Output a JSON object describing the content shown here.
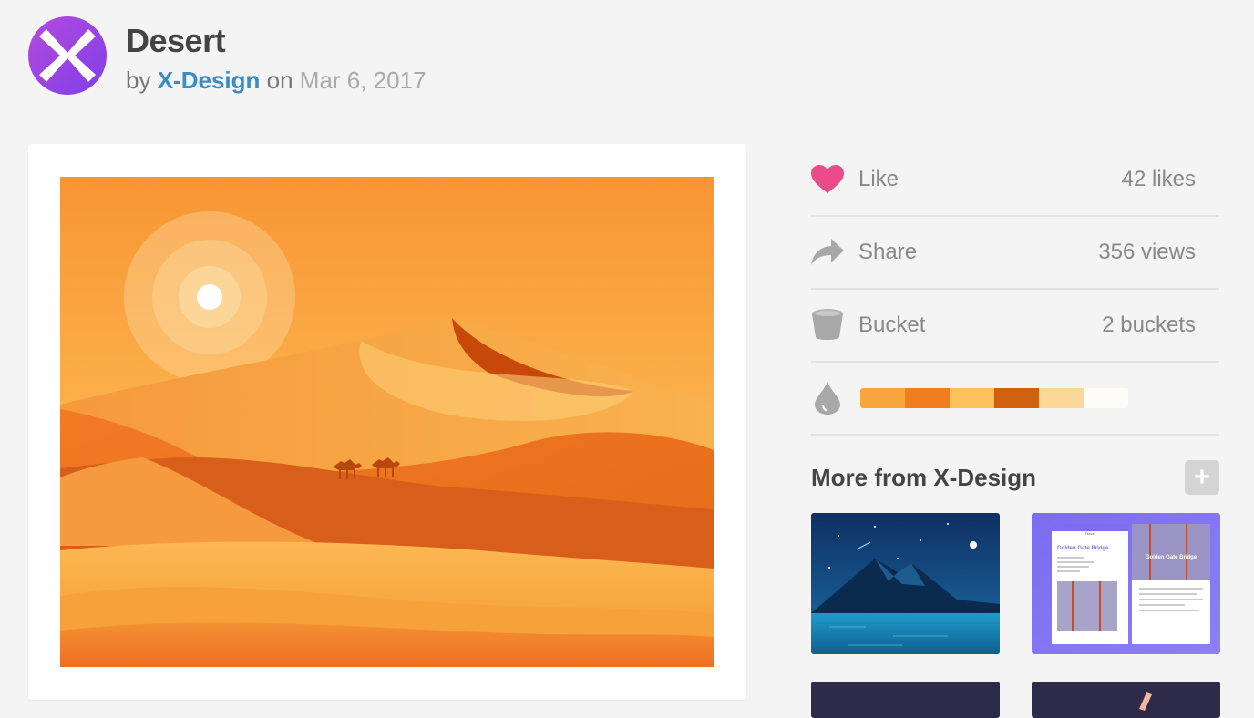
{
  "header": {
    "title": "Desert",
    "by": "by",
    "author": "X-Design",
    "on": "on",
    "date": "Mar 6, 2017",
    "avatar_letter": "X"
  },
  "stats": [
    {
      "icon": "heart-icon",
      "label": "Like",
      "value": "42 likes",
      "color": "#ea4c89"
    },
    {
      "icon": "share-icon",
      "label": "Share",
      "value": "356 views",
      "color": "#999999"
    },
    {
      "icon": "bucket-icon",
      "label": "Bucket",
      "value": "2 buckets",
      "color": "#999999"
    }
  ],
  "palette": {
    "icon": "drop-icon",
    "colors": [
      "#f9a63f",
      "#f07e1f",
      "#fbc15c",
      "#d0620f",
      "#fcd898",
      "#fdfcf8"
    ]
  },
  "more": {
    "heading": "More from X-Design",
    "add_label": "+",
    "thumbs": [
      {
        "name": "mountain-night-thumb",
        "texts": []
      },
      {
        "name": "golden-gate-app-thumb",
        "texts": [
          "Golden Gate Bridge",
          "Golden Gate Bridge",
          "Travel"
        ]
      },
      {
        "name": "dark-thumb-3",
        "texts": []
      },
      {
        "name": "dark-thumb-4",
        "texts": []
      }
    ]
  }
}
